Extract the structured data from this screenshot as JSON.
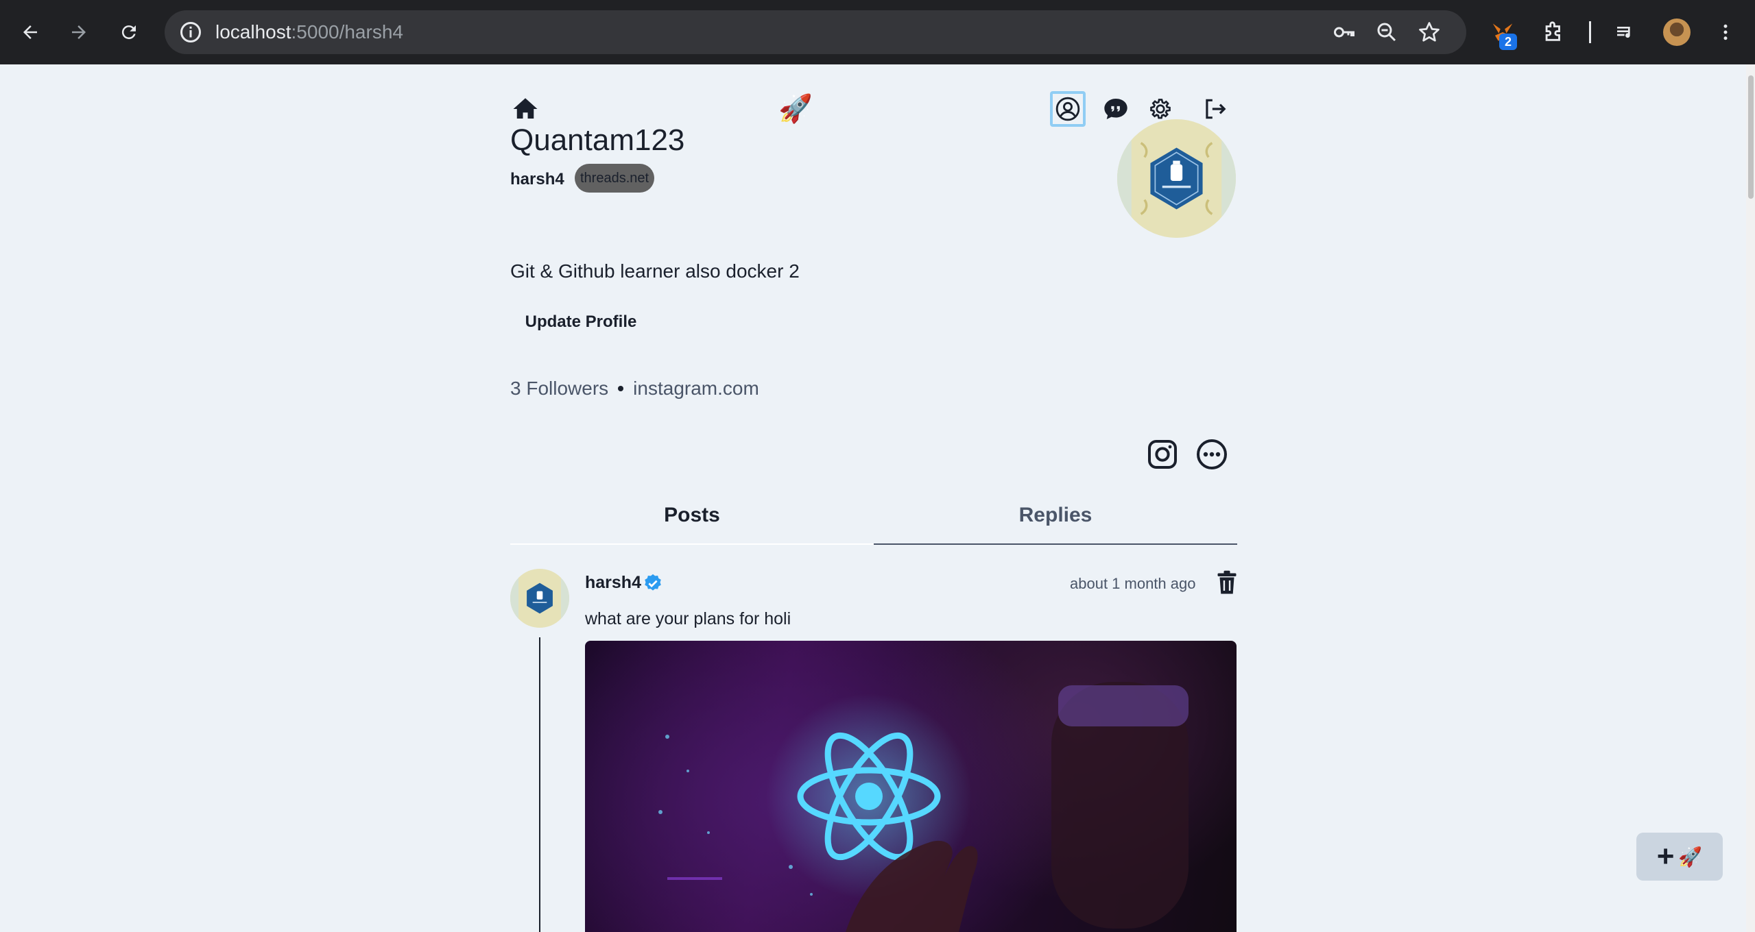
{
  "browser": {
    "url_host": "localhost",
    "url_path": ":5000/harsh4",
    "extension_badge": "2"
  },
  "header": {
    "logo_emoji": "🚀"
  },
  "profile": {
    "display_name": "Quantam123",
    "username": "harsh4",
    "domain_badge": "threads.net",
    "bio": "Git & Github learner also docker 2",
    "update_button": "Update Profile",
    "followers": "3 Followers",
    "link": "instagram.com"
  },
  "tabs": [
    {
      "label": "Posts",
      "active": true
    },
    {
      "label": "Replies",
      "active": false
    }
  ],
  "post": {
    "username": "harsh4",
    "verified": true,
    "time": "about 1 month ago",
    "text": "what are your plans for holi"
  },
  "fab": {
    "emoji": "🚀"
  },
  "colors": {
    "page_bg": "#edf2f7",
    "text": "#1a202c",
    "muted": "#4a5568",
    "accent": "#90cdf4",
    "verified": "#2b9bf0",
    "fab_bg": "#cbd5e0"
  },
  "icons": [
    "back-icon",
    "forward-icon",
    "reload-icon",
    "info-icon",
    "key-icon",
    "zoom-icon",
    "star-icon",
    "metamask-icon",
    "puzzle-icon",
    "media-icon",
    "more-vert-icon",
    "home-icon",
    "user-circle-icon",
    "chat-quote-icon",
    "gear-icon",
    "logout-icon",
    "instagram-icon",
    "more-circle-icon",
    "verified-icon",
    "trash-icon",
    "plus-icon"
  ]
}
